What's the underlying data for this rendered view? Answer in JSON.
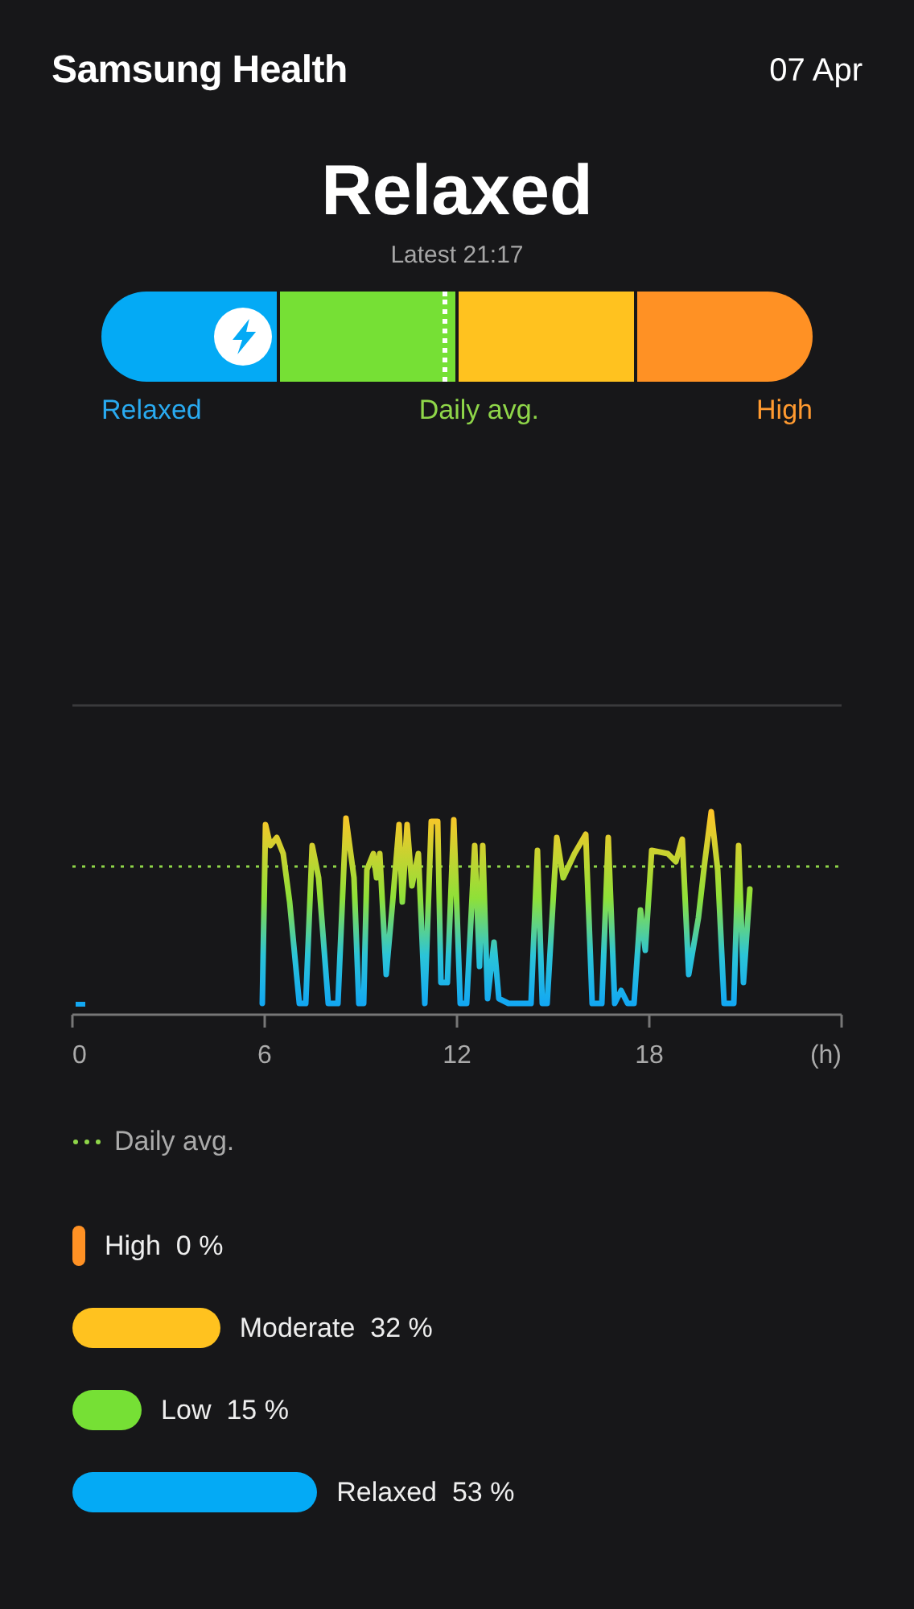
{
  "header": {
    "title": "Samsung Health",
    "date": "07 Apr"
  },
  "status": {
    "label": "Relaxed",
    "latest": "Latest 21:17"
  },
  "gauge": {
    "level": 0.2,
    "daily_avg": {
      "level": 0.48
    },
    "segments": [
      {
        "color": "#04aaf5"
      },
      {
        "color": "#76e035"
      },
      {
        "color": "#ffc21f"
      },
      {
        "color": "#ff9124"
      }
    ],
    "labels": [
      {
        "text": "Relaxed",
        "color": "#29aaf0"
      },
      {
        "text": "Daily avg.",
        "color": "#8fd649"
      },
      {
        "text": "High",
        "color": "#ff9a30"
      }
    ]
  },
  "graph": {
    "x_ticks": [
      "0",
      "6",
      "12",
      "18",
      "(h)"
    ],
    "legend": "Daily avg."
  },
  "breakdown": [
    {
      "name": "High",
      "value": "0 %",
      "color": "#ff9124"
    },
    {
      "name": "Moderate",
      "value": "32 %",
      "color": "#ffc21f"
    },
    {
      "name": "Low",
      "value": "15 %",
      "color": "#76e035"
    },
    {
      "name": "Relaxed",
      "value": "53 %",
      "color": "#04aaf5"
    }
  ]
}
